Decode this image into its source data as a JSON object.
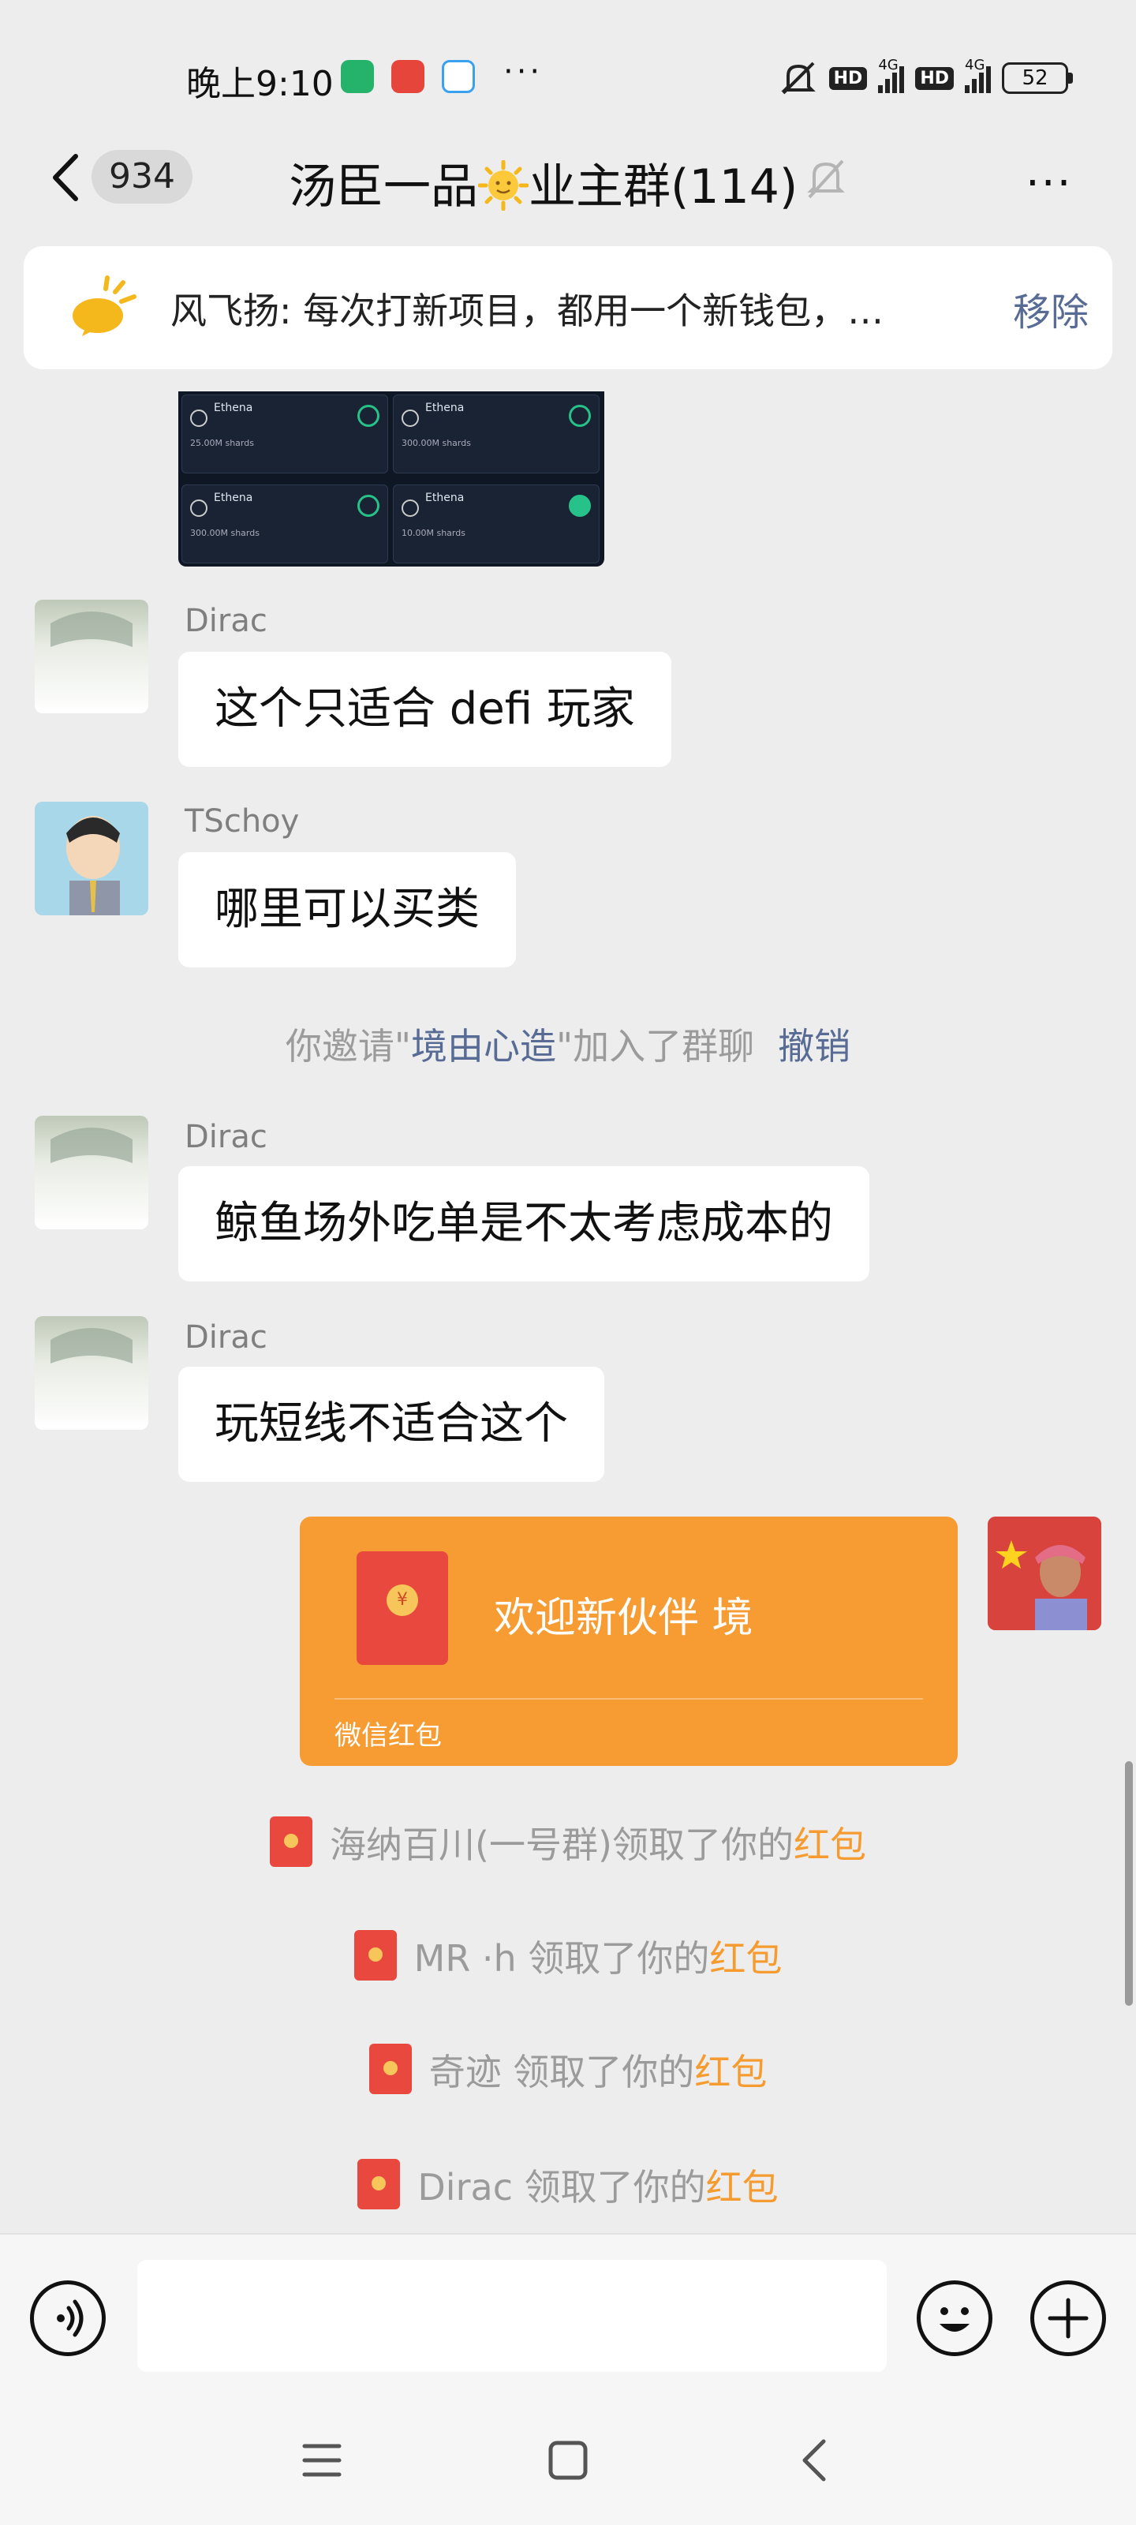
{
  "status_bar": {
    "time": "晚上9:10",
    "network_1": "4G",
    "network_2": "4G",
    "hd": "HD",
    "battery": "52"
  },
  "header": {
    "back_count": "934",
    "title_prefix": "汤臣一品",
    "title_suffix": "业主群(114)"
  },
  "pinned": {
    "text": "风飞扬: 每次打新项目，都用一个新钱包，…",
    "remove_label": "移除"
  },
  "image_cards": [
    {
      "title": "Ethena",
      "detail": "25.00M shards"
    },
    {
      "title": "Ethena",
      "detail": "300.00M shards"
    },
    {
      "title": "Ethena",
      "detail": "300.00M shards"
    },
    {
      "title": "Ethena",
      "detail": "10.00M shards"
    }
  ],
  "messages": [
    {
      "sender": "Dirac",
      "text": "这个只适合 defi 玩家"
    },
    {
      "sender": "TSchoy",
      "text": "哪里可以买类"
    },
    {
      "sender": "Dirac",
      "text": "鲸鱼场外吃单是不太考虑成本的"
    },
    {
      "sender": "Dirac",
      "text": "玩短线不适合这个"
    }
  ],
  "invite": {
    "prefix": "你邀请\"",
    "name": "境由心造",
    "suffix": "\"加入了群聊",
    "action": "撤销"
  },
  "red_packet": {
    "title": "欢迎新伙伴  境",
    "label": "微信红包",
    "seal": "¥"
  },
  "claims": [
    {
      "who": "海纳百川(一号群)领取了你的",
      "item": "红包"
    },
    {
      "who": "MR ·h 领取了你的",
      "item": "红包"
    },
    {
      "who": "奇迹 领取了你的",
      "item": "红包"
    },
    {
      "who": "Dirac 领取了你的",
      "item": "红包"
    }
  ],
  "input": {
    "placeholder": ""
  },
  "colors": {
    "accent_link": "#576b95",
    "red_packet": "#f79c33",
    "packet_red": "#e9483f",
    "bg": "#ededed"
  }
}
